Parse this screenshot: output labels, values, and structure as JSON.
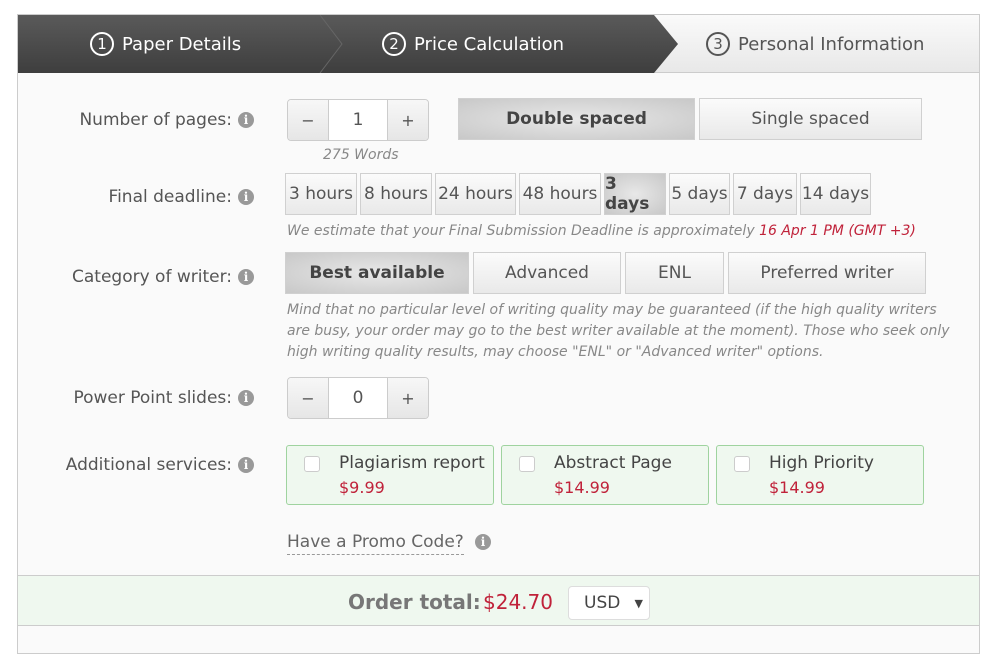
{
  "steps": [
    {
      "num": "1",
      "label": "Paper Details"
    },
    {
      "num": "2",
      "label": "Price Calculation"
    },
    {
      "num": "3",
      "label": "Personal Information"
    }
  ],
  "pages": {
    "label": "Number of pages:",
    "minus": "−",
    "value": "1",
    "plus": "+",
    "words": "275 Words",
    "spacing": [
      "Double spaced",
      "Single spaced"
    ],
    "selected_spacing": "Double spaced"
  },
  "deadline": {
    "label": "Final deadline:",
    "options": [
      "3 hours",
      "8 hours",
      "24 hours",
      "48 hours",
      "3 days",
      "5 days",
      "7 days",
      "14 days"
    ],
    "selected": "3 days",
    "note": "We estimate that your Final Submission Deadline is approximately",
    "date": "16 Apr 1 PM (GMT +3)"
  },
  "writer": {
    "label": "Category of writer:",
    "options": [
      "Best available",
      "Advanced",
      "ENL",
      "Preferred writer"
    ],
    "selected": "Best available",
    "note_lines": [
      "Mind that no particular level of writing quality may be guaranteed (if the high quality writers",
      "are busy, your order may go to the best writer available at the moment). Those who seek only",
      "high writing quality results, may choose \"ENL\" or \"Advanced writer\" options."
    ]
  },
  "slides": {
    "label": "Power Point slides:",
    "minus": "−",
    "value": "0",
    "plus": "+"
  },
  "services": {
    "label": "Additional services:",
    "items": [
      {
        "name": "Plagiarism report",
        "price": "$9.99",
        "checked": false
      },
      {
        "name": "Abstract Page",
        "price": "$14.99",
        "checked": false
      },
      {
        "name": "High Priority",
        "price": "$14.99",
        "checked": false
      }
    ]
  },
  "promo": {
    "label": "Have a Promo Code?"
  },
  "total": {
    "label": "Order total:",
    "amount": "$24.70",
    "currency": "USD"
  },
  "colors": {
    "price_red": "#c0223a",
    "service_green": "#9fd39f",
    "header_dark": "#4a4a4a"
  }
}
